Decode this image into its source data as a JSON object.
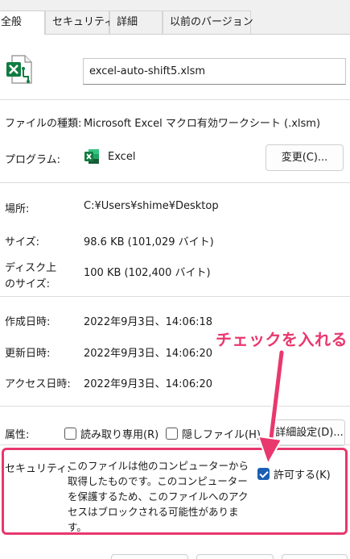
{
  "tabs": [
    {
      "label": "全般"
    },
    {
      "label": "セキュリティ"
    },
    {
      "label": "詳細"
    },
    {
      "label": "以前のバージョン"
    }
  ],
  "file": {
    "name": "excel-auto-shift5.xlsm",
    "icon": "excel-macro-file-icon"
  },
  "rows": {
    "type_label": "ファイルの種類:",
    "type_value": "Microsoft Excel マクロ有効ワークシート (.xlsm)",
    "program_label": "プログラム:",
    "program_value": "Excel",
    "change_button": "変更(C)...",
    "location_label": "場所:",
    "location_value": "C:¥Users¥shime¥Desktop",
    "size_label": "サイズ:",
    "size_value": "98.6 KB (101,029 バイト)",
    "disk_label_1": "ディスク上",
    "disk_label_2": "のサイズ:",
    "disk_value": "100 KB (102,400 バイト)",
    "created_label": "作成日時:",
    "created_value": "2022年9月3日、14:06:18",
    "modified_label": "更新日時:",
    "modified_value": "2022年9月3日、14:06:20",
    "accessed_label": "アクセス日時:",
    "accessed_value": "2022年9月3日、14:06:20"
  },
  "attributes": {
    "label": "属性:",
    "readonly_label": "読み取り専用(R)",
    "readonly_checked": false,
    "hidden_label": "隠しファイル(H)",
    "hidden_checked": false,
    "advanced_button": "詳細設定(D)..."
  },
  "security": {
    "label": "セキュリティ:",
    "message": "このファイルは他のコンピューターから取得したものです。このコンピューターを保護するため、このファイルへのアクセスはブロックされる可能性があります。",
    "allow_label": "許可する(K)",
    "allow_checked": true
  },
  "annotation": {
    "text": "チェックを入れる",
    "color": "#e8386e"
  },
  "colors": {
    "excel_green": "#107c41",
    "accent_blue": "#1a5fb4"
  }
}
